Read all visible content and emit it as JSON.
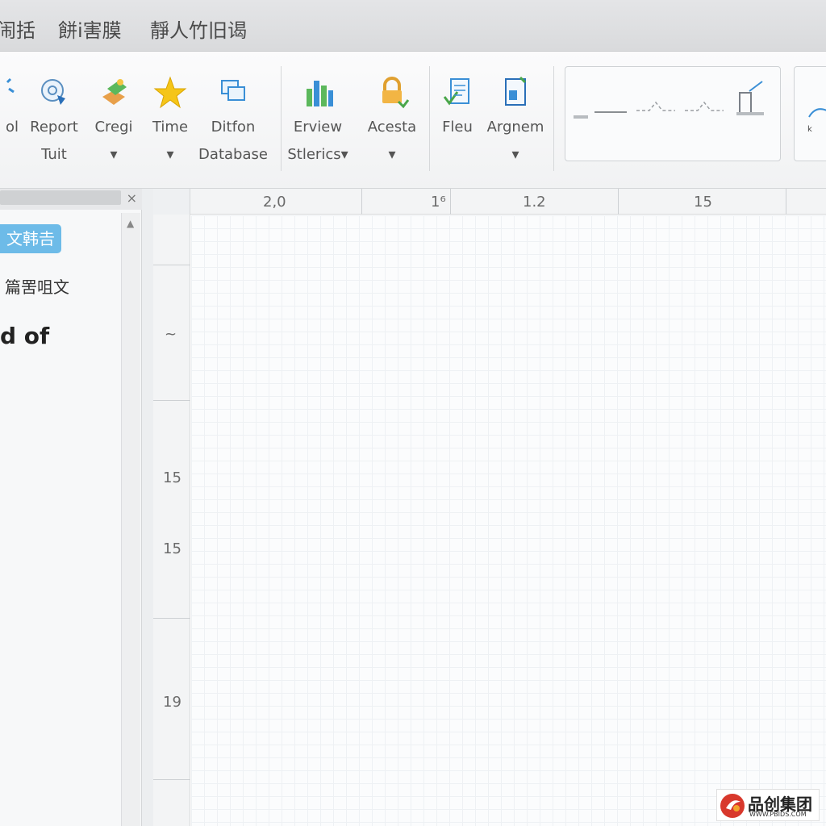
{
  "menu": {
    "items": [
      "闹括",
      "餅i害膜",
      "靜人竹旧谒"
    ]
  },
  "ribbon": {
    "buttons": [
      {
        "label": "ol",
        "label2": "",
        "icon": "tool-icon"
      },
      {
        "label": "Report",
        "label2": "Tuit",
        "icon": "report-icon"
      },
      {
        "label": "Cregi",
        "label2": "▾",
        "icon": "cube-icon"
      },
      {
        "label": "Time",
        "label2": "▾",
        "icon": "star-icon"
      },
      {
        "label": "Ditfon",
        "label2": "Database",
        "icon": "database-icon"
      },
      {
        "label": "Erview",
        "label2": "Stlerics▾",
        "icon": "bar-chart-icon"
      },
      {
        "label": "Acesta",
        "label2": "▾",
        "icon": "lock-icon"
      },
      {
        "label": "Fleu",
        "label2": "",
        "icon": "file-check-icon"
      },
      {
        "label": "Argnem",
        "label2": "▾",
        "icon": "document-icon"
      }
    ],
    "gallery_icon": "line-style-gallery-icon"
  },
  "left_panel": {
    "tag": "文韩𠮷",
    "subtitle": "篇罟咀文",
    "big_text": "d of"
  },
  "rulers": {
    "horizontal": [
      "2,0",
      "1⁶",
      "1.2",
      "15"
    ],
    "vertical": [
      "~",
      "15",
      "15",
      "19"
    ]
  },
  "watermark": {
    "text": "品创集团",
    "url": "WWW.PBIDS.COM"
  }
}
